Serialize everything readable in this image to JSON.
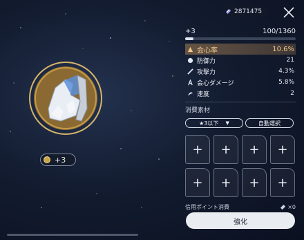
{
  "currency": {
    "icon": "star-rail-pass-icon",
    "amount": "2871475"
  },
  "relic": {
    "icon": "relic-gloves-icon",
    "level_label": "+3"
  },
  "panel": {
    "level": "+3",
    "exp_text": "100/1360",
    "exp_progress": 0.0735,
    "main_stat": {
      "name": "会心率",
      "value": "10.6%",
      "icon": "crit-rate-icon"
    },
    "sub_stats": [
      {
        "name": "防御力",
        "value": "21",
        "icon": "defense-icon"
      },
      {
        "name": "攻撃力",
        "value": "4.3%",
        "icon": "attack-icon"
      },
      {
        "name": "会心ダメージ",
        "value": "5.8%",
        "icon": "crit-damage-icon"
      },
      {
        "name": "速度",
        "value": "2",
        "icon": "speed-icon"
      }
    ]
  },
  "materials": {
    "title": "消費素材",
    "rarity_filter": "★3以下",
    "auto_select": "自動選択",
    "slot_symbol": "+"
  },
  "credit": {
    "label": "信用ポイント消費",
    "value": "×0"
  },
  "enhance_button": "強化",
  "colors": {
    "accent": "#f0c78a",
    "button": "#e9ecf1"
  }
}
